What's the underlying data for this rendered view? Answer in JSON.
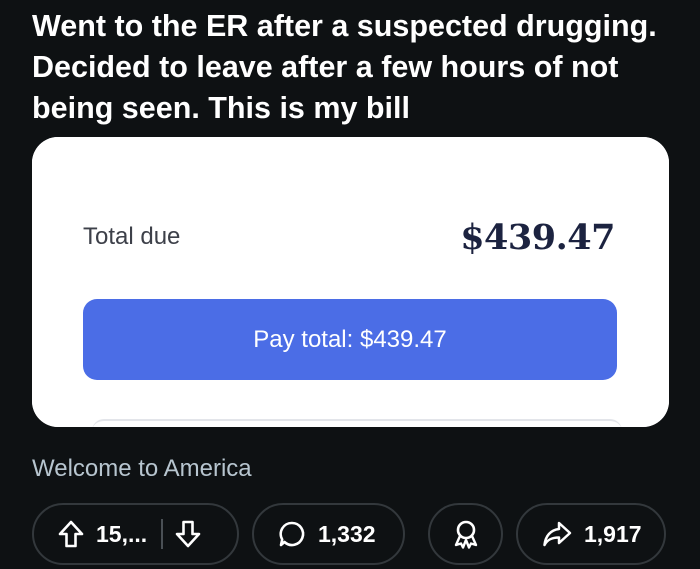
{
  "post": {
    "title": "Went to the ER after a suspected drugging. Decided to leave after a few hours of not being seen. This is my bill",
    "body": "Welcome to America"
  },
  "bill": {
    "total_label": "Total due",
    "total_amount": "$439.47",
    "pay_button_label": "Pay total: $439.47"
  },
  "actions": {
    "upvote_count": "15,...",
    "comment_count": "1,332",
    "share_count": "1,917"
  },
  "icons": {
    "upvote": "upvote-arrow-icon",
    "downvote": "downvote-arrow-icon",
    "comment": "comment-bubble-icon",
    "award": "award-ribbon-icon",
    "share": "share-arrow-icon"
  },
  "colors": {
    "background": "#0e1113",
    "pay_button": "#4b6de6",
    "amount_text": "#1c2340",
    "body_text": "#b7c5cf",
    "pill_border": "#33383c"
  }
}
